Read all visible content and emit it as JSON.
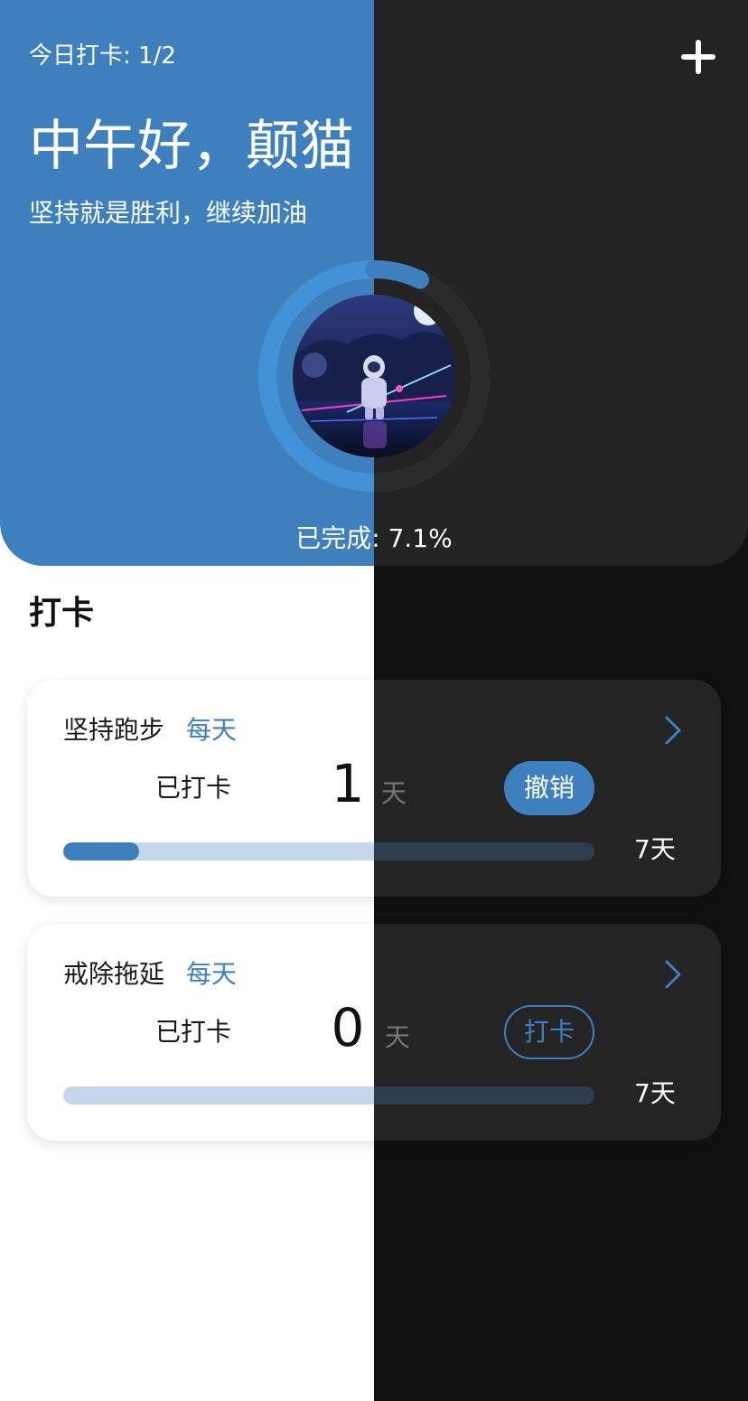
{
  "colors": {
    "accent": "#3e80be",
    "header_dark": "#232323",
    "page_dark": "#111111",
    "track_light": "#c4d7eb",
    "track_dark": "#2e3e50"
  },
  "header": {
    "checkin_count": "今日打卡: 1/2",
    "add_icon": "plus-icon",
    "greeting": "中午好，颠猫",
    "subtitle": "坚持就是胜利，继续加油",
    "avatar_description": "astronaut-avatar",
    "progress_fraction": 0.071,
    "completed_text": "已完成: 7.1%"
  },
  "section": {
    "title": "打卡"
  },
  "habits": [
    {
      "title": "坚持跑步",
      "frequency": "每天",
      "checked_label": "已打卡",
      "days": "1",
      "days_unit": "天",
      "action_label": "撤销",
      "action_style": "filled",
      "progress_fraction": 0.143,
      "goal_label": "7天",
      "chevron_icon": "chevron-right-icon"
    },
    {
      "title": "戒除拖延",
      "frequency": "每天",
      "checked_label": "已打卡",
      "days": "0",
      "days_unit": "天",
      "action_label": "打卡",
      "action_style": "outlined",
      "progress_fraction": 0,
      "goal_label": "7天",
      "chevron_icon": "chevron-right-icon"
    }
  ]
}
